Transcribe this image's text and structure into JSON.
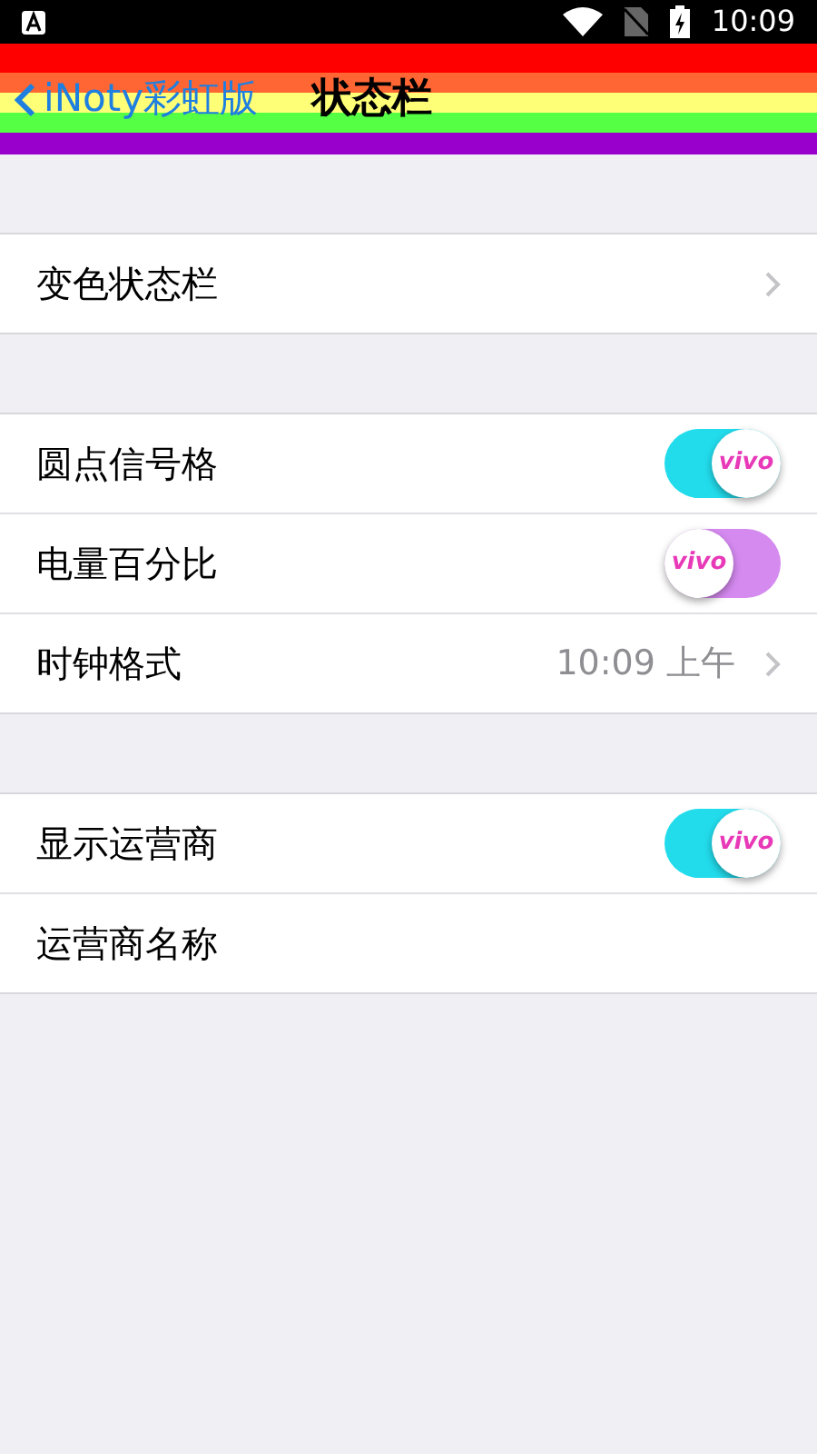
{
  "status_bar": {
    "time": "10:09"
  },
  "nav": {
    "back": "iNoty彩虹版",
    "title": "状态栏"
  },
  "sections": [
    {
      "rows": [
        {
          "kind": "link",
          "label": "变色状态栏"
        }
      ]
    },
    {
      "rows": [
        {
          "kind": "toggle",
          "label": "圆点信号格",
          "on": true,
          "thumb_text": "vivo"
        },
        {
          "kind": "toggle",
          "label": "电量百分比",
          "on": false,
          "thumb_text": "vivo"
        },
        {
          "kind": "link",
          "label": "时钟格式",
          "value": "10:09 上午"
        }
      ]
    },
    {
      "rows": [
        {
          "kind": "toggle",
          "label": "显示运营商",
          "on": true,
          "thumb_text": "vivo"
        },
        {
          "kind": "plain",
          "label": "运营商名称"
        }
      ]
    }
  ]
}
